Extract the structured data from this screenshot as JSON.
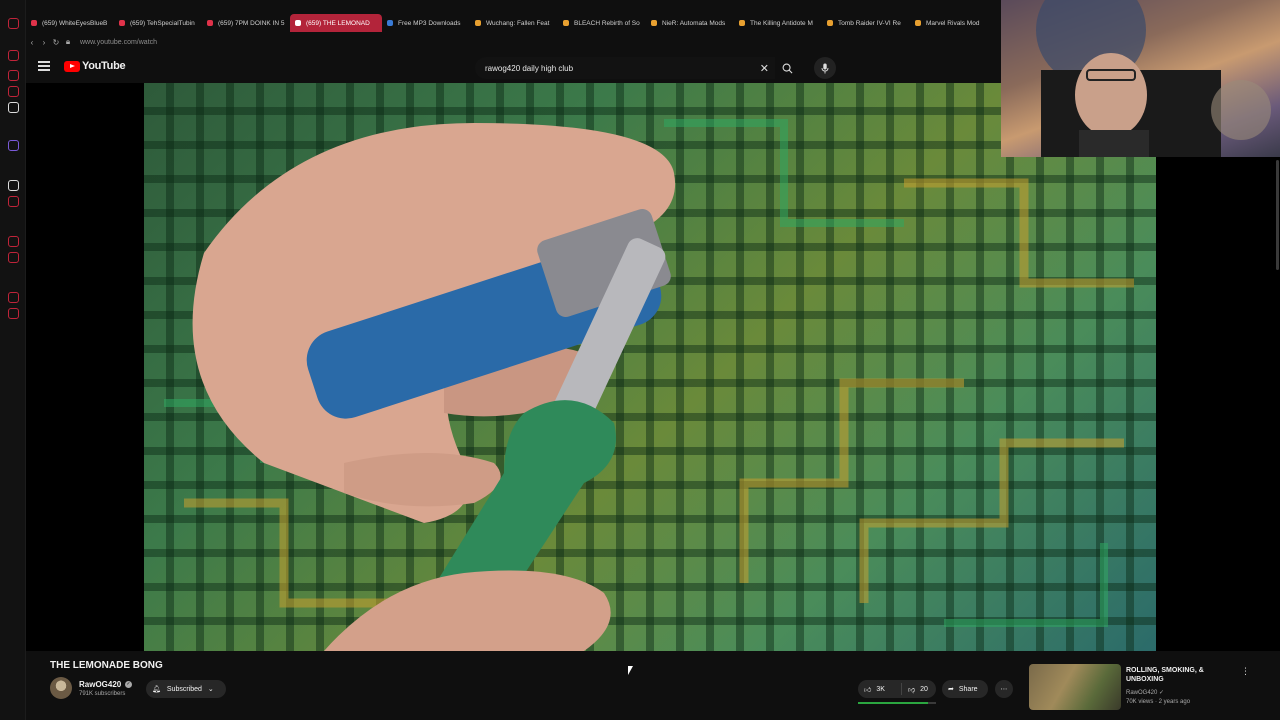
{
  "browser": {
    "tabs": [
      {
        "label": "(659) WhiteEyesBlueB",
        "color": "#e0324a",
        "active": false
      },
      {
        "label": "(659) TehSpecialTubin",
        "color": "#e0324a",
        "active": false
      },
      {
        "label": "(659) 7PM DOINK IN 5",
        "color": "#e0324a",
        "active": false
      },
      {
        "label": "(659) THE LEMONAD",
        "color": "#ffffff",
        "active": true
      },
      {
        "label": "Free MP3 Downloads",
        "color": "#3a7bd5",
        "active": false
      },
      {
        "label": "Wuchang: Fallen Feat",
        "color": "#e8a030",
        "active": false
      },
      {
        "label": "BLEACH Rebirth of So",
        "color": "#e8a030",
        "active": false
      },
      {
        "label": "NieR: Automata Mods",
        "color": "#e8a030",
        "active": false
      },
      {
        "label": "The Killing Antidote M",
        "color": "#e8a030",
        "active": false
      },
      {
        "label": "Tomb Raider IV-VI Re",
        "color": "#e8a030",
        "active": false
      },
      {
        "label": "Marvel Rivals Mod",
        "color": "#e8a030",
        "active": false
      }
    ],
    "url": "www.youtube.com/watch"
  },
  "youtube": {
    "logo_text": "YouTube",
    "search_query": "rawog420 daily high club",
    "accent": "#ff0000"
  },
  "video": {
    "title": "THE LEMONADE BONG",
    "channel": "RawOG420",
    "subscribers": "791K subscribers",
    "subscribe_label": "Subscribed",
    "likes": "3K",
    "dislikes": "20",
    "like_ratio": 0.9,
    "share_label": "Share"
  },
  "recommended": {
    "title": "ROLLING, SMOKING, & UNBOXING",
    "channel": "RawOG420",
    "meta": "70K views · 2 years ago"
  },
  "rail_colors": [
    "#c0243a",
    "#c0243a",
    "#c0243a",
    "#c0243a",
    "#ddd",
    "#7a5ad8",
    "#ddd",
    "#c0243a",
    "#c0243a",
    "#c0243a",
    "#c0243a",
    "#c0243a"
  ]
}
